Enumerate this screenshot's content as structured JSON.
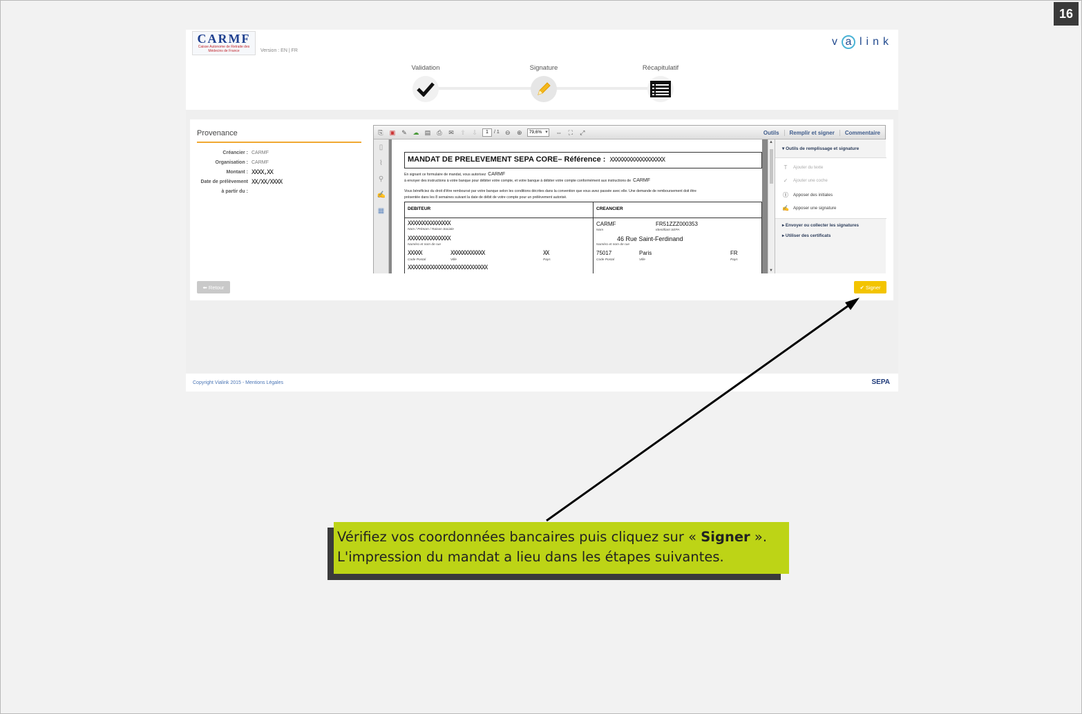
{
  "slide": {
    "number": "16"
  },
  "header": {
    "logo_text": "CARMF",
    "logo_subtitle": "Caisse Autonome de Retraite des Médecins de France",
    "version_label": "Version : EN | FR",
    "brand": "vialink"
  },
  "steps": [
    {
      "label": "Validation",
      "icon": "check-icon"
    },
    {
      "label": "Signature",
      "icon": "pencil-icon"
    },
    {
      "label": "Récapitulatif",
      "icon": "list-icon"
    }
  ],
  "provenance": {
    "title": "Provenance",
    "rows": [
      {
        "key": "Créancier :",
        "value": "CARMF"
      },
      {
        "key": "Organisation :",
        "value": "CARMF"
      },
      {
        "key": "Montant :",
        "value": "XXXX,XX"
      },
      {
        "key": "Date de prélèvement",
        "value": "XX/XX/XXXX"
      },
      {
        "key": "à partir du :",
        "value": ""
      }
    ]
  },
  "pdf_viewer": {
    "page_current": "1",
    "page_total": "/ 1",
    "zoom": "79,6%",
    "tabs": [
      "Outils",
      "Remplir et signer",
      "Commentaire"
    ],
    "document": {
      "title": "MANDAT DE PRELEVEMENT SEPA CORE– Référence :",
      "reference": "XXXXXXXXXXXXXXXXXX",
      "line1": "En signant ce formulaire de mandat, vous autorisez",
      "line1_value": "CARMF",
      "line2": "à envoyer des instructions à votre banque pour débiter votre compte, et votre banque à débiter votre compte conformément aux instructions de",
      "line2_value": "CARMF",
      "line3": "Vous bénéficiez du droit d'être remboursé par votre banque selon les conditions décrites dans la convention que vous avez passée avec elle. Une demande de remboursement doit être",
      "line4": "présentée dans les 8 semaines suivant la date de débit de votre compte pour un prélèvement autorisé.",
      "debiteur": {
        "header": "DEBITEUR",
        "name": "XXXXXXXXXXXXXXX",
        "name_caption": "Nom / Prénom / Raison Sociale",
        "street": "XXXXXXXXXXXXXXX",
        "street_caption": "Numéro et nom de rue",
        "postal": "XXXXX",
        "city": "XXXXXXXXXXXX",
        "country": "XX",
        "postal_caption": "Code Postal",
        "city_caption": "Ville",
        "country_caption": "Pays",
        "iban": "XXXXXXXXXXXXXXXXXXXXXXXXXXXX"
      },
      "creancier": {
        "header": "CREANCIER",
        "name": "CARMF",
        "sepa_id": "FR51ZZZ000353",
        "name_caption": "Nom",
        "sepa_caption": "Identifiant SEPA",
        "street": "46 Rue Saint-Ferdinand",
        "street_caption": "Numéro et nom de rue",
        "postal": "75017",
        "city": "Paris",
        "country": "FR",
        "postal_caption": "Code Postal",
        "city_caption": "Ville",
        "country_caption": "Pays"
      }
    },
    "right_panel": {
      "section": "Outils de remplissage et signature",
      "items": [
        {
          "label": "Ajouter du texte",
          "enabled": false
        },
        {
          "label": "Ajouter une coche",
          "enabled": false
        },
        {
          "label": "Apposer des initiales",
          "enabled": true
        },
        {
          "label": "Apposer une signature",
          "enabled": true
        }
      ],
      "links": [
        "Envoyer ou collecter les signatures",
        "Utiliser des certificats"
      ]
    }
  },
  "buttons": {
    "retour": "Retour",
    "signer": "Signer"
  },
  "footer": {
    "copyright": "Copyright Vialink 2015 - Mentions Légales",
    "sepa": "SEPA"
  },
  "callout": {
    "line1_before": "Vérifiez vos coordonnées bancaires puis cliquez sur « ",
    "line1_bold": "Signer",
    "line1_after": " ».",
    "line2": "L'impression du mandat a lieu dans les étapes suivantes."
  },
  "colors": {
    "accent_orange": "#f0a830",
    "signer_yellow": "#f3c400",
    "callout_green": "#bdd416"
  }
}
